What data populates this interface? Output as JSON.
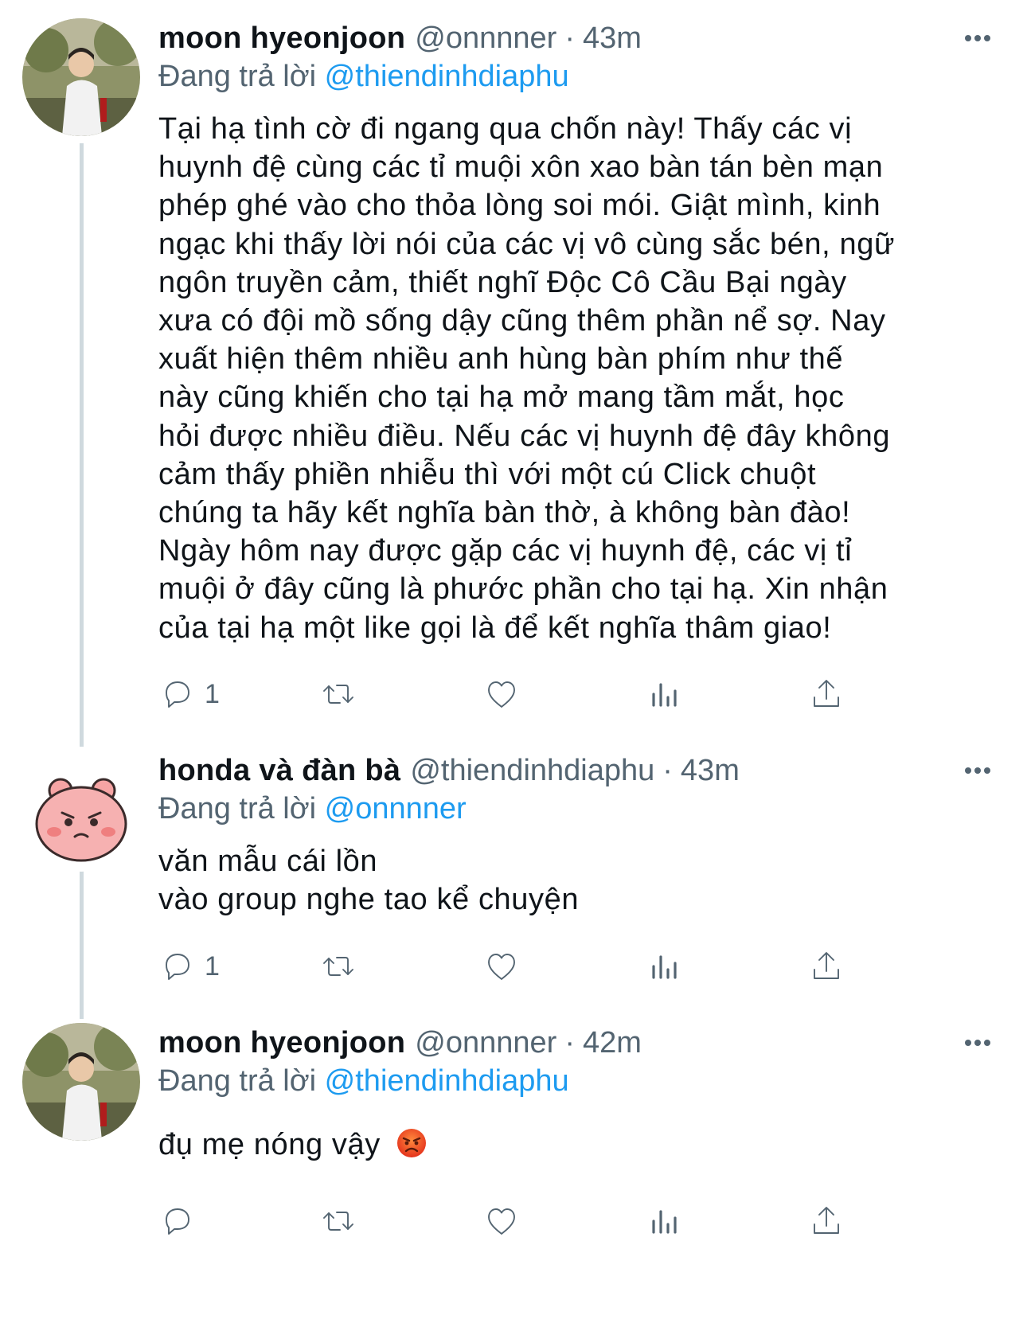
{
  "tweets": [
    {
      "name": "moon hyeonjoon",
      "handle": "@onnnner",
      "separator": "·",
      "time": "43m",
      "reply_prefix": "Đang trả lời",
      "reply_to": "@thiendinhdiaphu",
      "lines": [
        "Tại hạ tình cờ đi ngang qua chốn này! Thấy các vị",
        "huynh đệ cùng các tỉ muội xôn xao bàn tán bèn mạn",
        "phép ghé vào cho thỏa lòng soi mói. Giật mình, kinh",
        "ngạc khi thấy lời nói của các vị vô cùng sắc bén, ngữ",
        "ngôn truyền cảm, thiết nghĩ Độc Cô Cầu Bại ngày",
        "xưa có đội mồ sống dậy cũng thêm phần nể sợ. Nay",
        "xuất hiện thêm nhiều anh hùng bàn phím như thế",
        "này cũng khiến cho tại hạ mở mang tầm mắt, học",
        "hỏi được nhiều điều. Nếu các vị huynh đệ đây không",
        "cảm thấy phiền nhiễu thì với một cú Click chuột",
        "chúng ta hãy kết nghĩa bàn thờ, à không bàn đào!",
        "Ngày hôm nay được gặp các vị huynh đệ, các vị tỉ",
        "muội ở đây cũng là phước phần cho tại hạ. Xin nhận",
        "của tại hạ một like gọi là để kết nghĩa thâm giao!"
      ],
      "reply_count": "1"
    },
    {
      "name": "honda và đàn bà",
      "handle": "@thiendinhdiaphu",
      "separator": "·",
      "time": "43m",
      "reply_prefix": "Đang trả lời",
      "reply_to": "@onnnner",
      "lines": [
        "văn mẫu cái lồn",
        "vào group nghe tao kể chuyện"
      ],
      "reply_count": "1"
    },
    {
      "name": "moon hyeonjoon",
      "handle": "@onnnner",
      "separator": "·",
      "time": "42m",
      "reply_prefix": "Đang trả lời",
      "reply_to": "@thiendinhdiaphu",
      "lines": [
        "đụ mẹ nóng vậy"
      ],
      "emoji": "angry-face-icon",
      "reply_count": ""
    }
  ],
  "icons": {
    "more": "more-horizontal-icon",
    "reply": "reply-bubble-icon",
    "retweet": "retweet-icon",
    "like": "heart-icon",
    "views": "analytics-bars-icon",
    "share": "share-upload-icon"
  },
  "colors": {
    "link": "#1d9bf0",
    "secondary_text": "#536471",
    "primary_text": "#0f1419",
    "thread_line": "#cfd9de"
  }
}
